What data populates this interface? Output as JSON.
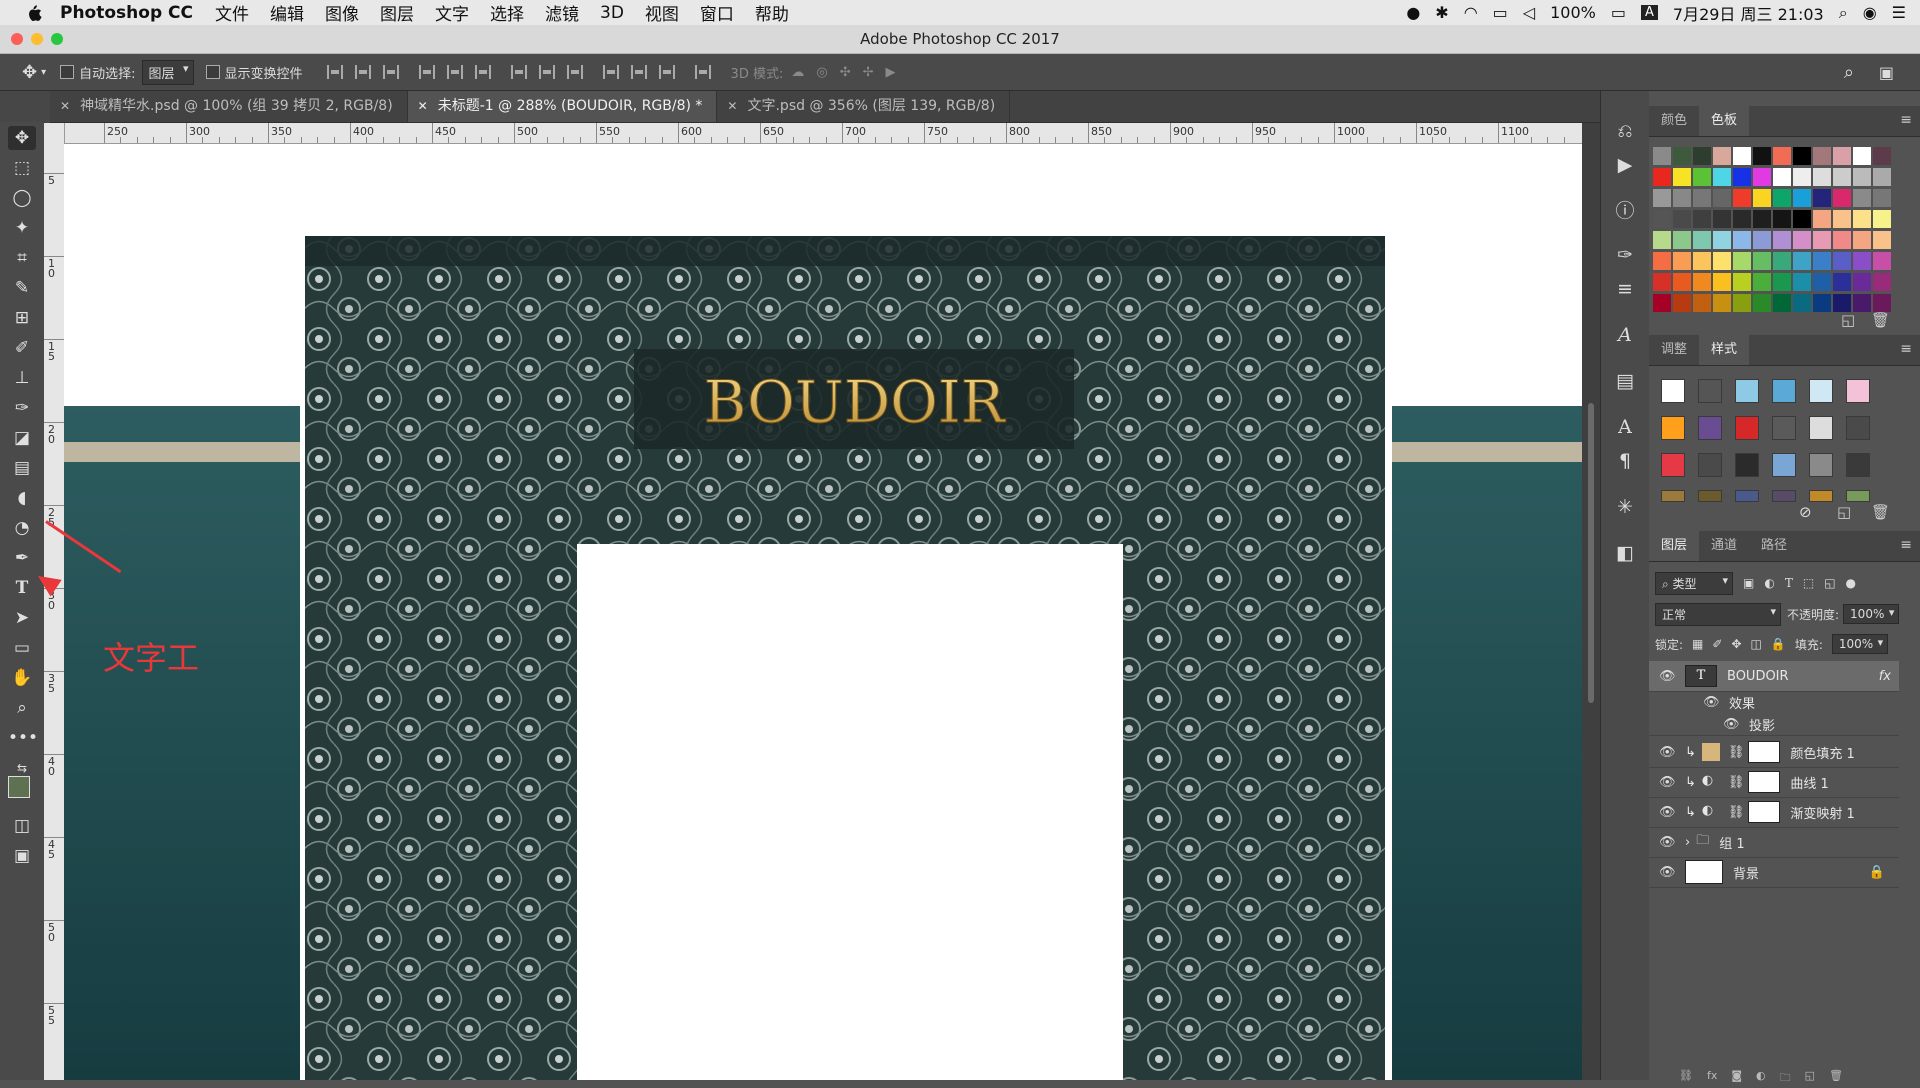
{
  "menubar": {
    "app_name": "Photoshop CC",
    "items": [
      "文件",
      "编辑",
      "图像",
      "图层",
      "文字",
      "选择",
      "滤镜",
      "3D",
      "视图",
      "窗口",
      "帮助"
    ],
    "status": {
      "battery": "100%",
      "input_method": "A",
      "datetime": "7月29日 周三 21:03"
    }
  },
  "window": {
    "title": "Adobe Photoshop CC 2017"
  },
  "options": {
    "auto_select_label": "自动选择:",
    "auto_select_value": "图层",
    "show_transform_label": "显示变换控件",
    "mode3d_label": "3D 模式:"
  },
  "tabs": [
    {
      "label": "神域精华水.psd @ 100% (组 39 拷贝 2, RGB/8)",
      "active": false
    },
    {
      "label": "未标题-1 @ 288% (BOUDOIR, RGB/8) *",
      "active": true
    },
    {
      "label": "文字.psd @ 356% (图层 139, RGB/8)",
      "active": false
    }
  ],
  "ruler": {
    "h_labels": [
      "250",
      "300",
      "350",
      "400",
      "450",
      "500",
      "550",
      "600",
      "650",
      "700",
      "750",
      "800",
      "850",
      "900",
      "950",
      "1000",
      "1050",
      "1100"
    ],
    "v_labels": [
      "5",
      "1 0",
      "1 5",
      "2 0",
      "2 5",
      "3 0",
      "3 5",
      "4 0",
      "4 5",
      "5 0",
      "5 5"
    ]
  },
  "canvas": {
    "sign_text": "BOUDOIR",
    "gold": "#d9b45a",
    "teal": "#1f4a4e"
  },
  "annotation": {
    "text": "文字工"
  },
  "panels": {
    "color_tabs": [
      "颜色",
      "色板"
    ],
    "style_tabs": [
      "调整",
      "样式"
    ],
    "layer_tabs": [
      "图层",
      "通道",
      "路径"
    ],
    "filter_label": "类型",
    "blend_mode": "正常",
    "opacity_label": "不透明度:",
    "opacity_value": "100%",
    "lock_label": "锁定:",
    "fill_label": "填充:",
    "fill_value": "100%",
    "layers": [
      {
        "name": "BOUDOIR",
        "fx": "fx"
      },
      {
        "name": "效果"
      },
      {
        "name": "投影"
      },
      {
        "name": "颜色填充 1"
      },
      {
        "name": "曲线 1"
      },
      {
        "name": "渐变映射 1"
      },
      {
        "name": "组 1"
      },
      {
        "name": "背景"
      }
    ]
  }
}
